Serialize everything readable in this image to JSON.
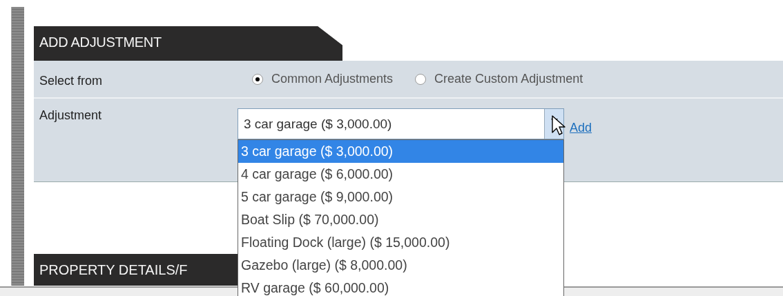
{
  "add_adjustment": {
    "title": "ADD ADJUSTMENT",
    "select_from": {
      "label": "Select from",
      "options": [
        {
          "label": "Common Adjustments",
          "selected": true
        },
        {
          "label": "Create Custom Adjustment",
          "selected": false
        }
      ]
    },
    "adjustment": {
      "label": "Adjustment",
      "value": "3 car garage ($ 3,000.00)",
      "expanded": true,
      "options": [
        {
          "label": "3 car garage ($ 3,000.00)",
          "selected": true
        },
        {
          "label": "4 car garage ($ 6,000.00)",
          "selected": false
        },
        {
          "label": "5 car garage ($ 9,000.00)",
          "selected": false
        },
        {
          "label": "Boat Slip ($ 70,000.00)",
          "selected": false
        },
        {
          "label": "Floating Dock (large) ($ 15,000.00)",
          "selected": false
        },
        {
          "label": "Gazebo (large) ($ 8,000.00)",
          "selected": false
        },
        {
          "label": "RV garage ($ 60,000.00)",
          "selected": false
        }
      ]
    },
    "add_link": "Add"
  },
  "property_details": {
    "title": "PROPERTY DETAILS/F"
  }
}
